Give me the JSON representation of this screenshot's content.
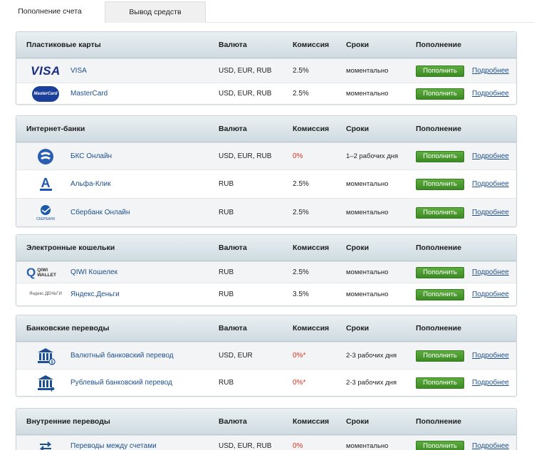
{
  "tabs": {
    "deposit": "Пополнение счета",
    "withdraw": "Вывод средств"
  },
  "columns": {
    "currency": "Валюта",
    "fee": "Комиссия",
    "term": "Сроки",
    "topup": "Пополнение"
  },
  "buttons": {
    "topup": "Пополнить",
    "more": "Подробнее"
  },
  "sections": [
    {
      "title": "Пластиковые карты",
      "rows": [
        {
          "icon": "visa-icon",
          "logo_text": "VISA",
          "name": "VISA",
          "currency": "USD, EUR, RUB",
          "fee": "2.5%",
          "fee_red": false,
          "term": "моментально"
        },
        {
          "icon": "mastercard-icon",
          "logo_text": "MasterCard",
          "name": "MasterCard",
          "currency": "USD, EUR, RUB",
          "fee": "2.5%",
          "fee_red": false,
          "term": "моментально"
        }
      ]
    },
    {
      "title": "Интернет-банки",
      "rows": [
        {
          "icon": "bcs-icon",
          "name": "БКС Онлайн",
          "currency": "USD, EUR, RUB",
          "fee": "0%",
          "fee_red": true,
          "term": "1–2 рабочих дня"
        },
        {
          "icon": "alfa-icon",
          "logo_text": "А",
          "name": "Альфа-Клик",
          "currency": "RUB",
          "fee": "2.5%",
          "fee_red": false,
          "term": "моментально"
        },
        {
          "icon": "sberbank-icon",
          "logo_text": "СБЕРБАНК",
          "name": "Сбербанк Онлайн",
          "currency": "RUB",
          "fee": "2.5%",
          "fee_red": false,
          "term": "моментально"
        }
      ]
    },
    {
      "title": "Электронные кошельки",
      "rows": [
        {
          "icon": "qiwi-icon",
          "logo_text": "QIWI WALLET",
          "name": "QIWI Кошелек",
          "currency": "RUB",
          "fee": "2.5%",
          "fee_red": false,
          "term": "моментально"
        },
        {
          "icon": "yandex-money-icon",
          "logo_text": "Яндекс ДЕНЬГИ",
          "name": "Яндекс.Деньги",
          "currency": "RUB",
          "fee": "3.5%",
          "fee_red": false,
          "term": "моментально"
        }
      ]
    },
    {
      "title": "Банковские переводы",
      "rows": [
        {
          "icon": "bank-currency-icon",
          "name": "Валютный банковский перевод",
          "currency": "USD, EUR",
          "fee": "0%*",
          "fee_red": true,
          "term": "2-3 рабочих дня"
        },
        {
          "icon": "bank-ruble-icon",
          "name": "Рублевый банковский перевод",
          "currency": "RUB",
          "fee": "0%*",
          "fee_red": true,
          "term": "2-3 рабочих дня"
        }
      ]
    },
    {
      "title": "Внутренние переводы",
      "rows": [
        {
          "icon": "transfer-arrows-icon",
          "name": "Переводы между счетами",
          "currency": "USD, EUR, RUB",
          "fee": "0%",
          "fee_red": true,
          "term": "моментально"
        }
      ]
    }
  ],
  "colors": {
    "button_green": "#4a9a2f",
    "link_blue": "#1d4f8c",
    "fee_red": "#e0301e",
    "header_bg": "#d5e0e6"
  }
}
